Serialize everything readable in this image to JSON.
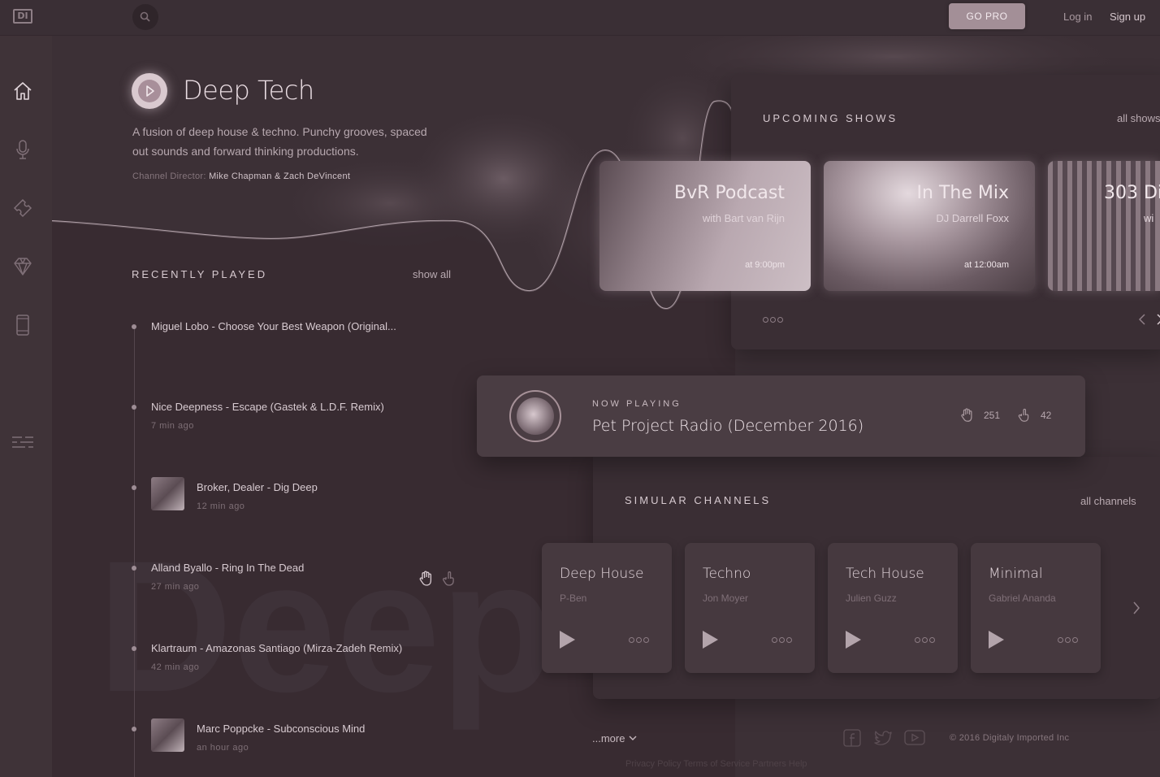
{
  "header": {
    "logo_text": "DI",
    "go_pro_label": "GO PRO",
    "login_label": "Log in",
    "signup_label": "Sign up"
  },
  "sidebar": {
    "items": [
      {
        "icon": "home-icon"
      },
      {
        "icon": "microphone-icon"
      },
      {
        "icon": "ticket-icon"
      },
      {
        "icon": "diamond-icon"
      },
      {
        "icon": "mobile-device-icon"
      },
      {
        "icon": "sliders-icon"
      }
    ]
  },
  "channel": {
    "title": "Deep Tech",
    "description": "A fusion of deep house & techno. Punchy grooves, spaced out sounds and forward thinking productions.",
    "director_label": "Channel Director:",
    "director_names": "Mike Chapman & Zach DeVincent",
    "watermark": "Deep"
  },
  "recently_played": {
    "heading": "RECENTLY PLAYED",
    "show_all_label": "show all",
    "items": [
      {
        "title": "Miguel Lobo - Choose Your Best Weapon (Original...",
        "time": "",
        "has_thumb": false
      },
      {
        "title": "Nice Deepness - Escape (Gastek & L.D.F. Remix)",
        "time": "7 min ago",
        "has_thumb": false
      },
      {
        "title": "Broker, Dealer - Dig Deep",
        "time": "12 min ago",
        "has_thumb": true
      },
      {
        "title": "Alland Byallo - Ring In The Dead",
        "time": "27 min ago",
        "has_thumb": false
      },
      {
        "title": "Klartraum - Amazonas Santiago (Mirza-Zadeh Remix)",
        "time": "42 min ago",
        "has_thumb": false
      },
      {
        "title": "Marc Poppcke - Subconscious Mind",
        "time": "an hour ago",
        "has_thumb": true
      }
    ]
  },
  "upcoming": {
    "heading": "UPCOMING SHOWS",
    "all_label": "all shows",
    "shows": [
      {
        "title": "BvR Podcast",
        "subtitle": "with Bart van Rijn",
        "time": "at 9:00pm"
      },
      {
        "title": "In The Mix",
        "subtitle": "DJ Darrell Foxx",
        "time": "at 12:00am"
      },
      {
        "title": "303 Di",
        "subtitle": "wi",
        "time": ""
      }
    ]
  },
  "now_playing": {
    "label": "NOW PLAYING",
    "title": "Pet Project Radio (December 2016)",
    "likes": "251",
    "dislikes": "42"
  },
  "similar": {
    "heading": "SIMULAR CHANNELS",
    "all_label": "all channels",
    "channels": [
      {
        "name": "Deep House",
        "director": "P-Ben"
      },
      {
        "name": "Techno",
        "director": "Jon Moyer"
      },
      {
        "name": "Tech House",
        "director": "Julien Guzz"
      },
      {
        "name": "Minimal",
        "director": "Gabriel Ananda"
      }
    ]
  },
  "footer": {
    "more_label": "...more",
    "copyright": "© 2016 Digitaly Imported Inc",
    "ghost_links": "Privacy Policy    Terms of Service    Partners    Help"
  },
  "colors": {
    "background": "#3c3036",
    "panel": "#3a2e34",
    "accent": "#a38f97"
  }
}
